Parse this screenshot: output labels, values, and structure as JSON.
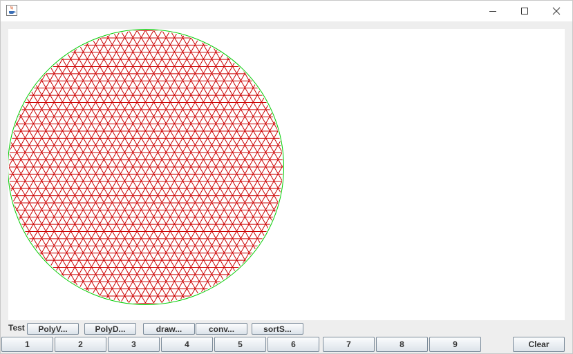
{
  "window": {
    "icon": "java-coffee-icon",
    "controls": {
      "minimize": "minimize-icon",
      "maximize": "maximize-icon",
      "close": "close-icon"
    }
  },
  "canvas": {
    "circle_color": "#00cc00",
    "mesh_color": "#cc0000",
    "background": "#ffffff"
  },
  "test_row": {
    "label": "Test",
    "buttons": [
      "PolyV...",
      "PolyD...",
      "draw...",
      "conv...",
      "sortS..."
    ]
  },
  "number_row": {
    "buttons": [
      "1",
      "2",
      "3",
      "4",
      "5",
      "6",
      "7",
      "8",
      "9"
    ],
    "clear_label": "Clear"
  }
}
